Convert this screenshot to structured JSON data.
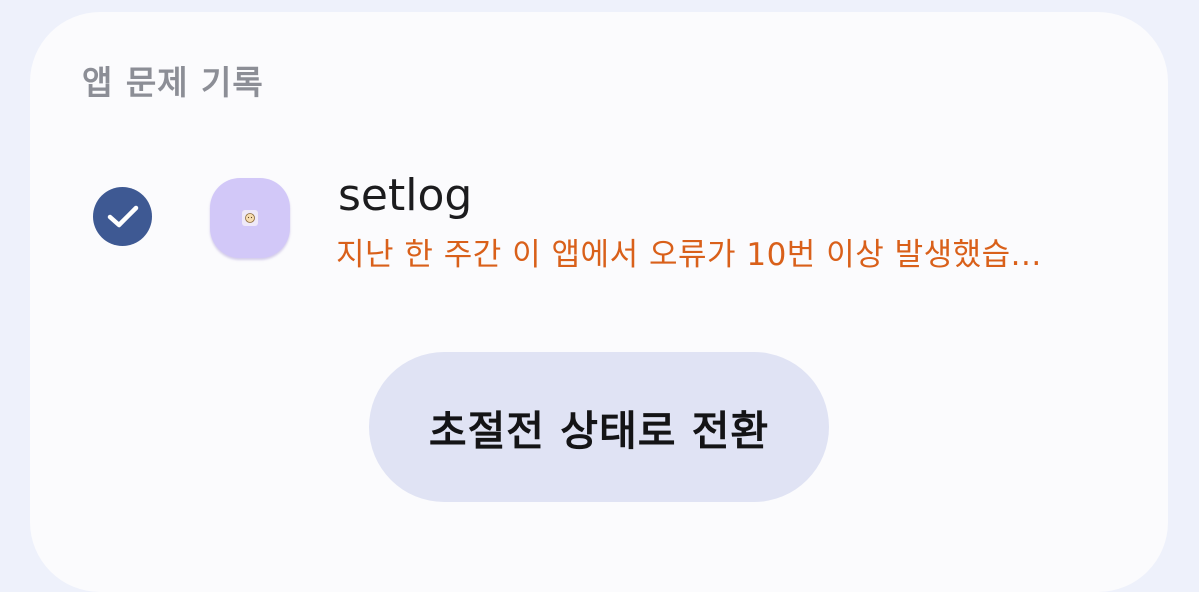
{
  "section": {
    "title": "앱 문제 기록"
  },
  "app": {
    "name": "setlog",
    "description": "지난 한 주간 이 앱에서 오류가 10번 이상 발생했습...",
    "selected": true,
    "icon": "app-placeholder-icon"
  },
  "button": {
    "label": "초절전 상태로 전환"
  },
  "colors": {
    "background": "#eef1fb",
    "card": "#fbfbfd",
    "checkbox": "#3e5993",
    "warning_text": "#d9601a",
    "app_icon_bg": "#d2c8f8",
    "button_bg": "#e0e3f4"
  }
}
